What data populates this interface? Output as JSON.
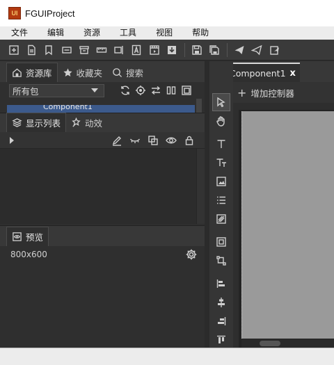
{
  "window": {
    "title": "FGUIProject",
    "logo_text": "UI"
  },
  "menu": [
    "文件",
    "编辑",
    "资源",
    "工具",
    "视图",
    "帮助"
  ],
  "toolbar_icons": [
    "add-window-icon",
    "new-document-icon",
    "bookmark-icon",
    "minus-box-icon",
    "trash-icon",
    "ruler-icon",
    "split-icon",
    "text-frame-icon",
    "film-icon",
    "import-icon",
    "save-icon",
    "save-all-icon",
    "send-icon",
    "send-outline-icon",
    "publish-icon"
  ],
  "library_tabs": [
    {
      "label": "资源库",
      "icon": "library-icon"
    },
    {
      "label": "收藏夹",
      "icon": "star-icon"
    },
    {
      "label": "搜索",
      "icon": "search-icon"
    }
  ],
  "package_select": {
    "value": "所有包"
  },
  "library_item": {
    "label": "Component1"
  },
  "display_tabs": [
    {
      "label": "显示列表",
      "icon": "layers-icon"
    },
    {
      "label": "动效",
      "icon": "effects-icon"
    }
  ],
  "preview": {
    "tab_label": "预览",
    "size": "800x600"
  },
  "document_tab": {
    "label": "Component1",
    "close": "x"
  },
  "controller_bar": {
    "add_label": "增加控制器"
  },
  "accent": {
    "selection_blue": "#3c5a8c",
    "stage_gray": "#9a9a9a",
    "logo_red": "#b23a10"
  }
}
